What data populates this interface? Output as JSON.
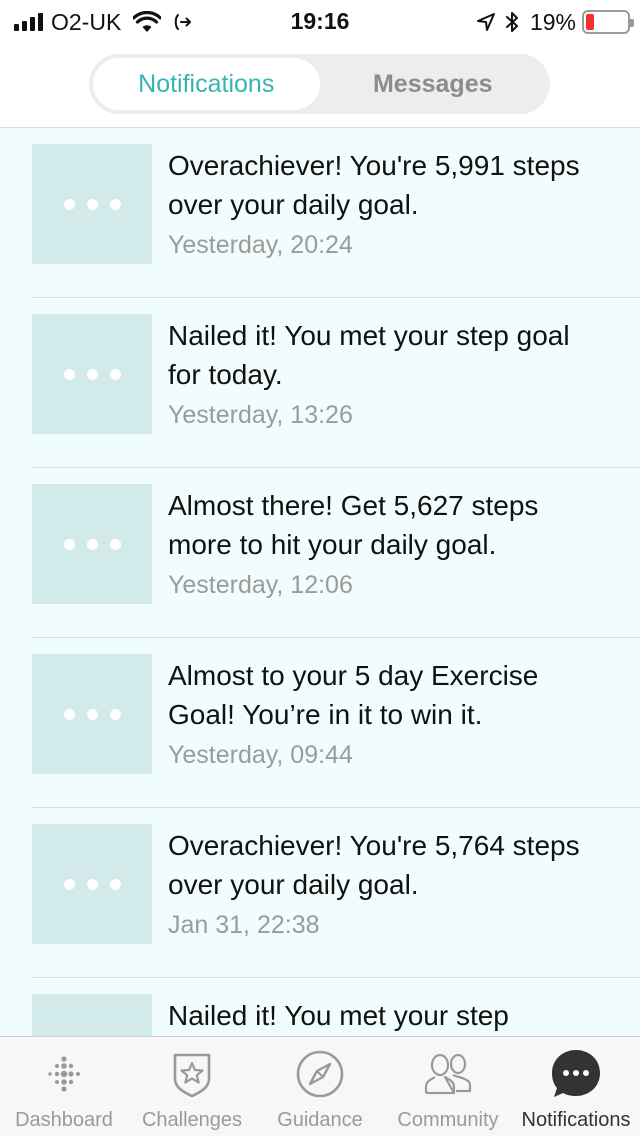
{
  "status_bar": {
    "carrier": "O2-UK",
    "time": "19:16",
    "battery_percent": "19%",
    "battery_level": 0.19,
    "icons": [
      "signal-icon",
      "wifi-icon",
      "call-forward-icon",
      "location-arrow-icon",
      "bluetooth-icon",
      "battery-icon"
    ]
  },
  "segmented": {
    "tabs": [
      {
        "label": "Notifications",
        "active": true
      },
      {
        "label": "Messages",
        "active": false
      }
    ]
  },
  "notifications": [
    {
      "message": "Overachiever! You're 5,991 steps over your daily goal.",
      "time": "Yesterday, 20:24"
    },
    {
      "message": "Nailed it! You met your step goal for today.",
      "time": "Yesterday, 13:26"
    },
    {
      "message": "Almost there! Get 5,627 steps more to hit your daily goal.",
      "time": "Yesterday, 12:06"
    },
    {
      "message": "Almost to your 5 day Exercise Goal! You’re in it to win it.",
      "time": "Yesterday, 09:44"
    },
    {
      "message": "Overachiever! You're 5,764 steps over your daily goal.",
      "time": "Jan 31, 22:38"
    },
    {
      "message": "Nailed it! You met your step",
      "time": ""
    }
  ],
  "tabbar": {
    "items": [
      {
        "label": "Dashboard",
        "icon": "fitbit-dots-icon",
        "active": false
      },
      {
        "label": "Challenges",
        "icon": "star-shield-icon",
        "active": false
      },
      {
        "label": "Guidance",
        "icon": "compass-icon",
        "active": false
      },
      {
        "label": "Community",
        "icon": "people-icon",
        "active": false
      },
      {
        "label": "Notifications",
        "icon": "chat-bubble-icon",
        "active": true
      }
    ]
  },
  "colors": {
    "accent": "#35b5b0",
    "list_background": "#f1fcfc",
    "thumb_background": "#d2eaea",
    "battery_low": "#f0332d"
  }
}
